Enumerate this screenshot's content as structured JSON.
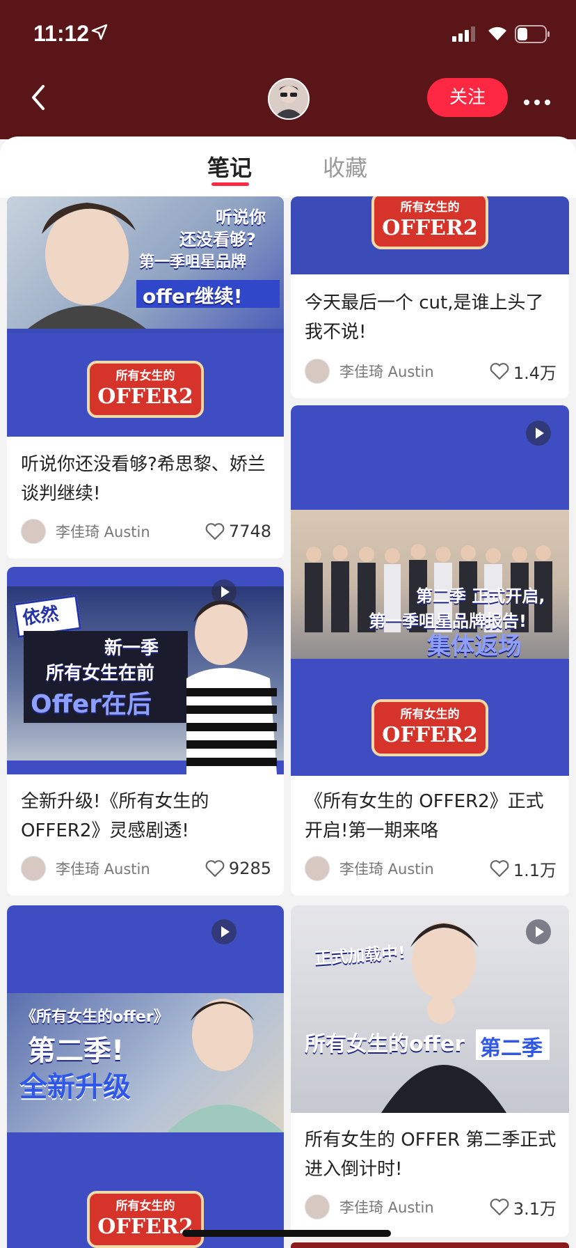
{
  "status_bar": {
    "time": "11:12"
  },
  "header": {
    "follow_label": "关注"
  },
  "tabs": [
    {
      "label": "笔记"
    },
    {
      "label": "收藏"
    }
  ],
  "thumb_text": {
    "c1_a": "听说你",
    "c1_b": "还没看够?",
    "c1_c": "第一季咀星品牌",
    "c1_d": "offer继续!",
    "logo_l1": "所有女生的",
    "logo_l2": "OFFER2",
    "c3_a": "依然",
    "c3_b": "新一季",
    "c3_c": "所有女生在前",
    "c3_d": "Offer在后",
    "c4_a": "第二季 正式开启,",
    "c4_b": "第一季咀星品牌报告!",
    "c4_c": "集体返场",
    "c5_a": "《所有女生的offer》",
    "c5_b": "第二季!",
    "c5_c": "全新升级",
    "c6_a": "正式加载中!",
    "c6_b": "所有女生的offer",
    "c6_c": "第二季"
  },
  "cards": [
    {
      "title": "听说你还没看够?希思黎、娇兰谈判继续!",
      "author": "李佳琦 Austin",
      "likes": "7748"
    },
    {
      "title": "今天最后一个 cut,是谁上头了我不说!",
      "author": "李佳琦 Austin",
      "likes": "1.4万"
    },
    {
      "title": "全新升级!《所有女生的 OFFER2》灵感剧透!",
      "author": "李佳琦 Austin",
      "likes": "9285"
    },
    {
      "title": "《所有女生的 OFFER2》正式开启!第一期来咯",
      "author": "李佳琦 Austin",
      "likes": "1.1万"
    },
    {
      "title": "",
      "author": "",
      "likes": ""
    },
    {
      "title": "所有女生的 OFFER 第二季正式进入倒计时!",
      "author": "李佳琦 Austin",
      "likes": "3.1万"
    }
  ]
}
